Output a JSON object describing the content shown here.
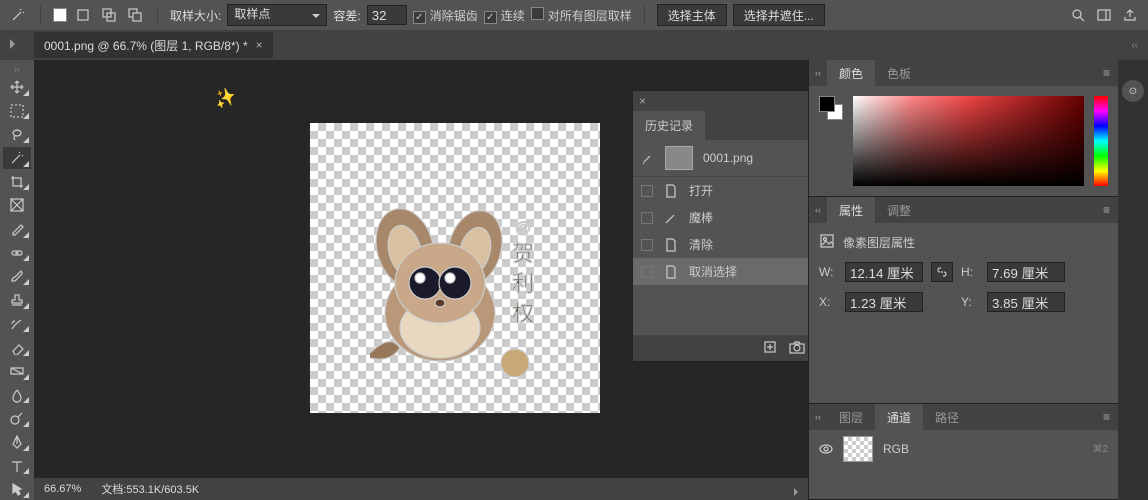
{
  "topbar": {
    "sample_label": "取样大小:",
    "sample_value": "取样点",
    "tolerance_label": "容差:",
    "tolerance_value": "32",
    "antialias": "消除锯齿",
    "contiguous": "连续",
    "all_layers": "对所有图层取样",
    "select_subject": "选择主体",
    "select_mask": "选择并遮住..."
  },
  "tab": {
    "title": "0001.png @ 66.7% (图层 1, RGB/8*) *"
  },
  "history": {
    "title": "历史记录",
    "snapshot": "0001.png",
    "steps": [
      "打开",
      "魔棒",
      "清除",
      "取消选择"
    ]
  },
  "panels": {
    "color": {
      "tab1": "颜色",
      "tab2": "色板"
    },
    "props": {
      "tab1": "属性",
      "tab2": "调整",
      "subtitle": "像素图层属性",
      "w_label": "W:",
      "w_value": "12.14 厘米",
      "h_label": "H:",
      "h_value": "7.69 厘米",
      "x_label": "X:",
      "x_value": "1.23 厘米",
      "y_label": "Y:",
      "y_value": "3.85 厘米"
    },
    "layers": {
      "tab1": "图层",
      "tab2": "通道",
      "tab3": "路径",
      "rgb": "RGB",
      "badge": "⌘2"
    }
  },
  "status": {
    "zoom": "66.67%",
    "doc": "文档:553.1K/603.5K"
  },
  "canvas_text": "@ 贺 利 权"
}
